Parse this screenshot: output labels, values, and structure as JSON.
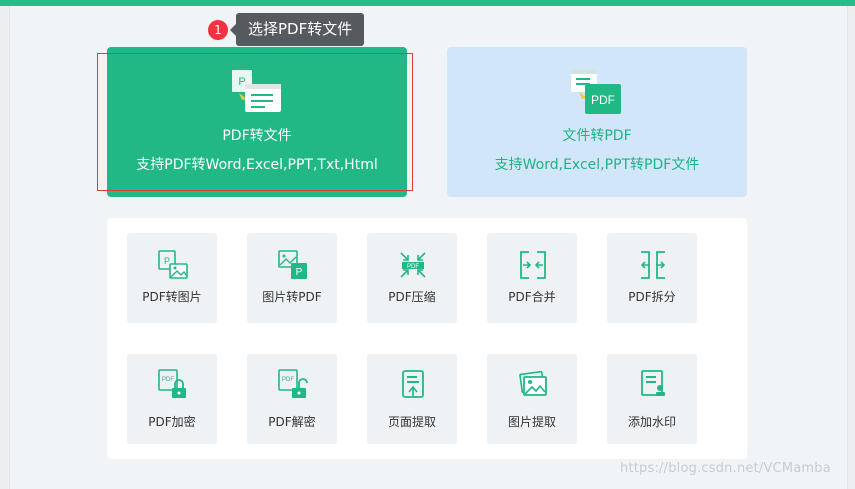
{
  "step": {
    "number": "1",
    "tooltip": "选择PDF转文件"
  },
  "cards": [
    {
      "title": "PDF转文件",
      "desc": "支持PDF转Word,Excel,PPT,Txt,Html",
      "icon": "pdf-to-file-icon"
    },
    {
      "title": "文件转PDF",
      "desc": "支持Word,Excel,PPT转PDF文件",
      "icon": "file-to-pdf-icon"
    }
  ],
  "tools": [
    {
      "label": "PDF转图片",
      "icon": "pdf-to-image-icon"
    },
    {
      "label": "图片转PDF",
      "icon": "image-to-pdf-icon"
    },
    {
      "label": "PDF压缩",
      "icon": "pdf-compress-icon"
    },
    {
      "label": "PDF合并",
      "icon": "pdf-merge-icon"
    },
    {
      "label": "PDF拆分",
      "icon": "pdf-split-icon"
    },
    {
      "label": "PDF加密",
      "icon": "pdf-encrypt-icon"
    },
    {
      "label": "PDF解密",
      "icon": "pdf-decrypt-icon"
    },
    {
      "label": "页面提取",
      "icon": "page-extract-icon"
    },
    {
      "label": "图片提取",
      "icon": "image-extract-icon"
    },
    {
      "label": "添加水印",
      "icon": "add-watermark-icon"
    }
  ],
  "icon_text": {
    "pdf": "PDF",
    "p": "P"
  },
  "watermark": "https://blog.csdn.net/VCMamba",
  "colors": {
    "accent": "#21b886",
    "card_light": "#d2e6f9",
    "marker": "#f2323d",
    "tooltip_bg": "#565a5e",
    "highlight": "#e23b3b"
  }
}
